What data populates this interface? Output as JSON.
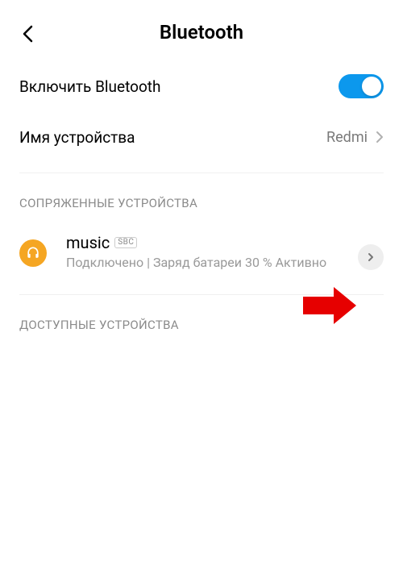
{
  "header": {
    "title": "Bluetooth"
  },
  "settings": {
    "enable_label": "Включить Bluetooth",
    "enabled": true,
    "device_name_label": "Имя устройства",
    "device_name_value": "Redmi"
  },
  "sections": {
    "paired_title": "СОПРЯЖЕННЫЕ УСТРОЙСТВА",
    "available_title": "ДОСТУПНЫЕ УСТРОЙСТВА"
  },
  "paired_devices": [
    {
      "name": "music",
      "codec": "SBC",
      "status": "Подключено | Заряд батареи 30 % Активно",
      "icon": "headphones"
    }
  ],
  "colors": {
    "accent": "#0c98ed",
    "device_icon_bg": "#f5a623",
    "annotation_arrow": "#e60000"
  }
}
